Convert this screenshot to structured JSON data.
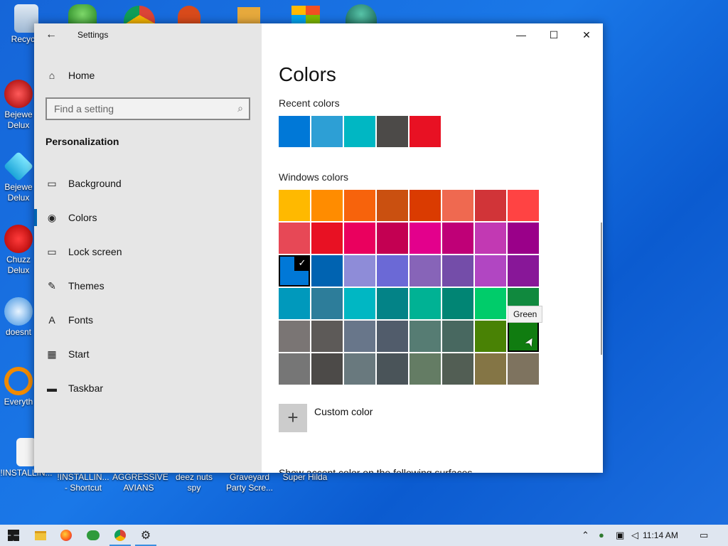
{
  "desktop": {
    "icons": [
      {
        "label": "Recycle"
      },
      {
        "label": "Bejewe Delux"
      },
      {
        "label": "Bejewe Delux"
      },
      {
        "label": "Chuzz Delux"
      },
      {
        "label": "doesnt"
      },
      {
        "label": "Everyth"
      },
      {
        "label": "!INSTALLIN..."
      },
      {
        "label": "!INSTALLIN... - Shortcut"
      },
      {
        "label": "AGGRESSIVE AVIANS"
      },
      {
        "label": "deez nuts spy"
      },
      {
        "label": "Graveyard Party Scre..."
      },
      {
        "label": "Super Hilda"
      }
    ]
  },
  "window": {
    "app_title": "Settings",
    "controls": {
      "minimize": "—",
      "maximize": "☐",
      "close": "✕"
    }
  },
  "sidebar": {
    "home_label": "Home",
    "search_placeholder": "Find a setting",
    "section_title": "Personalization",
    "items": [
      {
        "label": "Background",
        "icon": "image-icon"
      },
      {
        "label": "Colors",
        "icon": "palette-icon"
      },
      {
        "label": "Lock screen",
        "icon": "lock-screen-icon"
      },
      {
        "label": "Themes",
        "icon": "themes-icon"
      },
      {
        "label": "Fonts",
        "icon": "fonts-icon"
      },
      {
        "label": "Start",
        "icon": "start-icon"
      },
      {
        "label": "Taskbar",
        "icon": "taskbar-icon"
      }
    ],
    "selected": "Colors"
  },
  "main": {
    "title": "Colors",
    "recent_label": "Recent colors",
    "recent_colors": [
      "#0078d7",
      "#2d9fd5",
      "#00b7c3",
      "#4c4a48",
      "#e81123"
    ],
    "windows_label": "Windows colors",
    "windows_colors": [
      [
        "#ffb900",
        "#ff8c00",
        "#f7630c",
        "#ca5010",
        "#da3b01",
        "#ef6950",
        "#d13438",
        "#ff4343"
      ],
      [
        "#e74856",
        "#e81123",
        "#ea005e",
        "#c30052",
        "#e3008c",
        "#bf0077",
        "#c239b3",
        "#9a0089"
      ],
      [
        "#0078d7",
        "#0063b1",
        "#8e8cd8",
        "#6b69d6",
        "#8764b8",
        "#744da9",
        "#b146c2",
        "#881798"
      ],
      [
        "#0099bc",
        "#2d7d9a",
        "#00b7c3",
        "#038387",
        "#00b294",
        "#018574",
        "#00cc6a",
        "#10893e"
      ],
      [
        "#7a7574",
        "#5d5a58",
        "#68768a",
        "#515c6b",
        "#567c73",
        "#486860",
        "#498205",
        "#107c10"
      ],
      [
        "#767676",
        "#4c4a48",
        "#69797e",
        "#4a5459",
        "#647c64",
        "#525e54",
        "#847545",
        "#7e735f"
      ]
    ],
    "selected_swatch": {
      "row": 2,
      "col": 0
    },
    "hovered_swatch": {
      "row": 4,
      "col": 7
    },
    "tooltip": "Green",
    "custom_color_label": "Custom color",
    "accent_surfaces_label": "Show accent color on the following surfaces"
  },
  "taskbar": {
    "apps": [
      {
        "icon": "windows-start-icon"
      },
      {
        "icon": "file-explorer-icon"
      },
      {
        "icon": "firefox-icon"
      },
      {
        "icon": "games-icon"
      },
      {
        "icon": "chrome-icon"
      },
      {
        "icon": "settings-gear-icon"
      }
    ],
    "time": "11:14 AM"
  }
}
